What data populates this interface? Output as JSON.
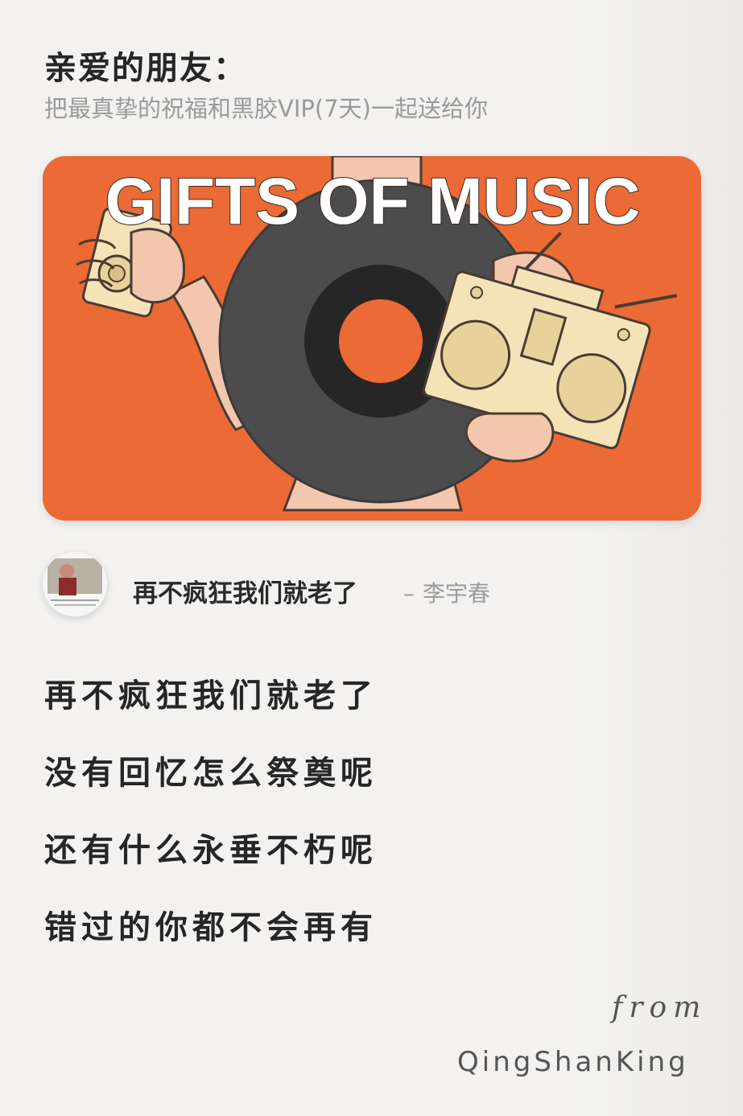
{
  "header": {
    "greeting": "亲爱的朋友：",
    "subline": "把最真挚的祝福和黑胶VIP(7天)一起送给你"
  },
  "card": {
    "title": "GIFTS OF MUSIC",
    "background_color": "#ec6a35"
  },
  "song": {
    "title": "再不疯狂我们就老了",
    "dash": "–",
    "artist": "李宇春"
  },
  "lyrics": [
    "再不疯狂我们就老了",
    "没有回忆怎么祭奠呢",
    "还有什么永垂不朽呢",
    "错过的你都不会再有"
  ],
  "signature": {
    "from_label": "from",
    "sender": "QingShanKing"
  }
}
